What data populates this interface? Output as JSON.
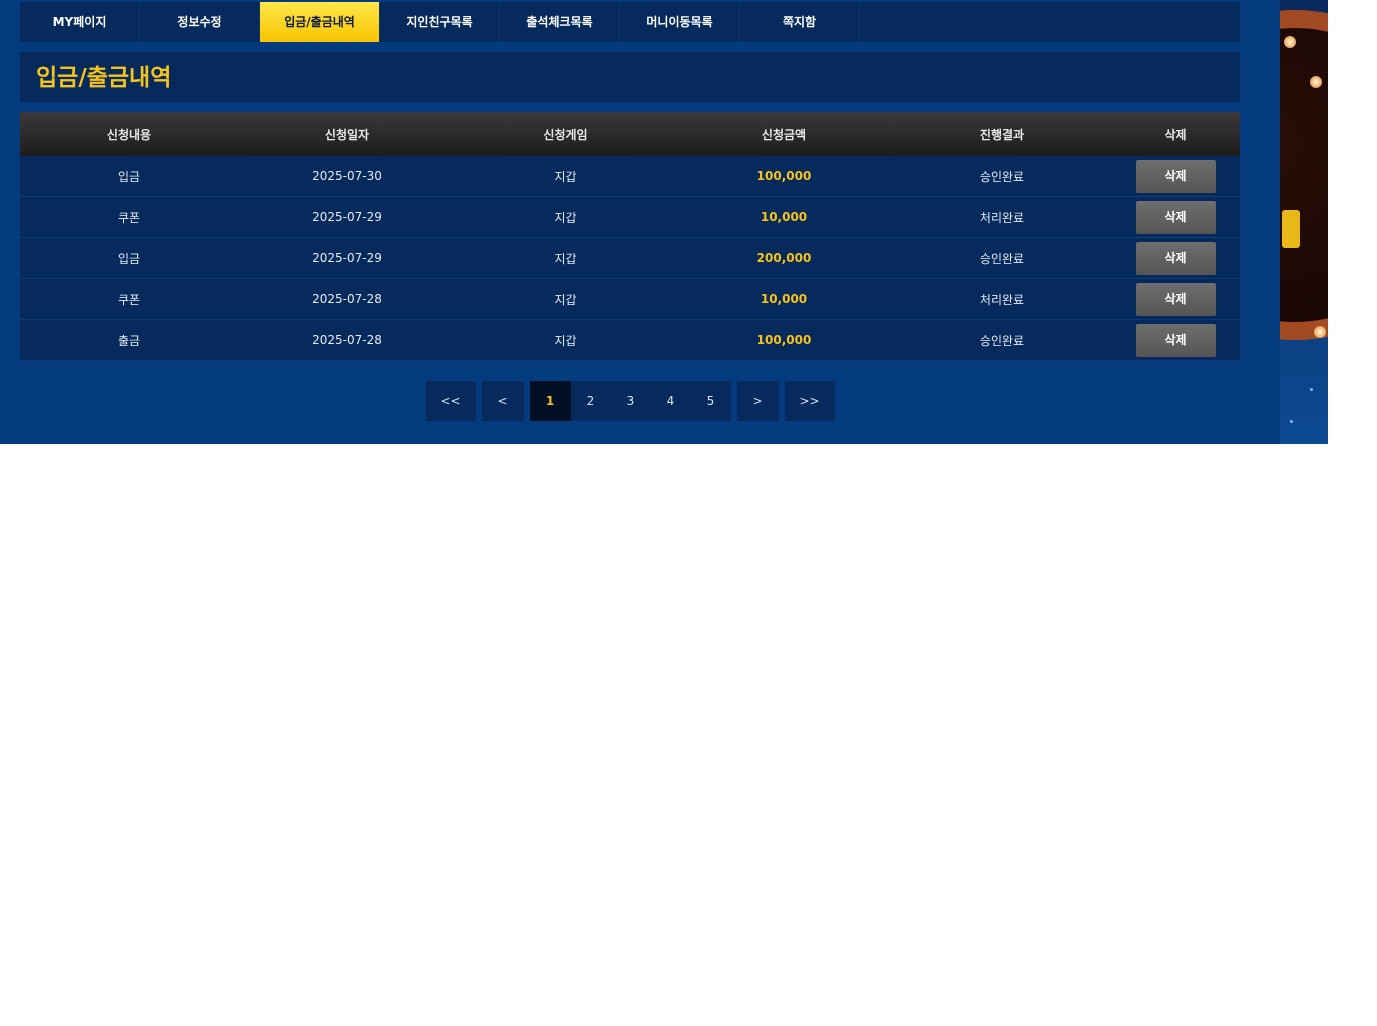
{
  "tabs": [
    {
      "label": "MY페이지"
    },
    {
      "label": "정보수정"
    },
    {
      "label": "입금/출금내역"
    },
    {
      "label": "지인친구목록"
    },
    {
      "label": "출석체크목록"
    },
    {
      "label": "머니이동목록"
    },
    {
      "label": "쪽지함"
    }
  ],
  "active_tab": "입금/출금내역",
  "page_title": "입금/출금내역",
  "table": {
    "headers": [
      "신청내용",
      "신청일자",
      "신청게임",
      "신청금액",
      "진행결과",
      "삭제"
    ],
    "rows": [
      {
        "type": "입금",
        "date": "2025-07-30",
        "game": "지갑",
        "amount": "100,000",
        "result": "승인완료",
        "delete_label": "삭제"
      },
      {
        "type": "쿠폰",
        "date": "2025-07-29",
        "game": "지갑",
        "amount": "10,000",
        "result": "처리완료",
        "delete_label": "삭제"
      },
      {
        "type": "입금",
        "date": "2025-07-29",
        "game": "지갑",
        "amount": "200,000",
        "result": "승인완료",
        "delete_label": "삭제"
      },
      {
        "type": "쿠폰",
        "date": "2025-07-28",
        "game": "지갑",
        "amount": "10,000",
        "result": "처리완료",
        "delete_label": "삭제"
      },
      {
        "type": "출금",
        "date": "2025-07-28",
        "game": "지갑",
        "amount": "100,000",
        "result": "승인완료",
        "delete_label": "삭제"
      }
    ]
  },
  "pagination": {
    "first": "<<",
    "prev": "<",
    "pages": [
      "1",
      "2",
      "3",
      "4",
      "5"
    ],
    "current": "1",
    "next": ">",
    "last": ">>"
  },
  "colors": {
    "background": "#043a7e",
    "panel": "#062a5c",
    "accent": "#f7c21a",
    "active_tab": "#f7c400"
  }
}
